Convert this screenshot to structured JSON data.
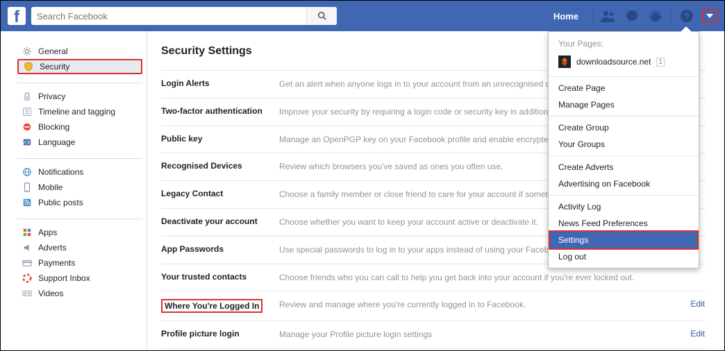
{
  "topbar": {
    "search_placeholder": "Search Facebook",
    "home": "Home"
  },
  "sidebar": {
    "group1": [
      {
        "icon": "gear",
        "label": "General"
      },
      {
        "icon": "shield",
        "label": "Security",
        "active": true,
        "highlight": true
      }
    ],
    "group2": [
      {
        "icon": "lock",
        "label": "Privacy"
      },
      {
        "icon": "timeline",
        "label": "Timeline and tagging"
      },
      {
        "icon": "block",
        "label": "Blocking"
      },
      {
        "icon": "lang",
        "label": "Language"
      }
    ],
    "group3": [
      {
        "icon": "globe",
        "label": "Notifications"
      },
      {
        "icon": "mobile",
        "label": "Mobile"
      },
      {
        "icon": "rss",
        "label": "Public posts"
      }
    ],
    "group4": [
      {
        "icon": "apps",
        "label": "Apps"
      },
      {
        "icon": "ad",
        "label": "Adverts"
      },
      {
        "icon": "card",
        "label": "Payments"
      },
      {
        "icon": "support",
        "label": "Support Inbox"
      },
      {
        "icon": "video",
        "label": "Videos"
      }
    ]
  },
  "main": {
    "title": "Security Settings",
    "rows": [
      {
        "label": "Login Alerts",
        "desc": "Get an alert when anyone logs in to your account from an unrecognised device or browser."
      },
      {
        "label": "Two-factor authentication",
        "desc": "Improve your security by requiring a login code or security key in addition to your password."
      },
      {
        "label": "Public key",
        "desc": "Manage an OpenPGP key on your Facebook profile and enable encrypted notifications."
      },
      {
        "label": "Recognised Devices",
        "desc": "Review which browsers you've saved as ones you often use."
      },
      {
        "label": "Legacy Contact",
        "desc": "Choose a family member or close friend to care for your account if something happens."
      },
      {
        "label": "Deactivate your account",
        "desc": "Choose whether you want to keep your account active or deactivate it."
      },
      {
        "label": "App Passwords",
        "desc": "Use special passwords to log in to your apps instead of using your Facebook password or login codes."
      },
      {
        "label": "Your trusted contacts",
        "desc": "Choose friends who you can call to help you get back into your account if you're ever locked out."
      },
      {
        "label": "Where You're Logged In",
        "desc": "Review and manage where you're currently logged in to Facebook.",
        "edit": "Edit",
        "hl": true
      },
      {
        "label": "Profile picture login",
        "desc": "Manage your Profile picture login settings",
        "edit": "Edit"
      }
    ]
  },
  "dropdown": {
    "header": "Your Pages:",
    "page_name": "downloadsource.net",
    "page_badge": "1",
    "groups": [
      [
        "Create Page",
        "Manage Pages"
      ],
      [
        "Create Group",
        "Your Groups"
      ],
      [
        "Create Adverts",
        "Advertising on Facebook"
      ],
      [
        "Activity Log",
        "News Feed Preferences",
        "Settings",
        "Log out"
      ]
    ],
    "selected": "Settings"
  }
}
